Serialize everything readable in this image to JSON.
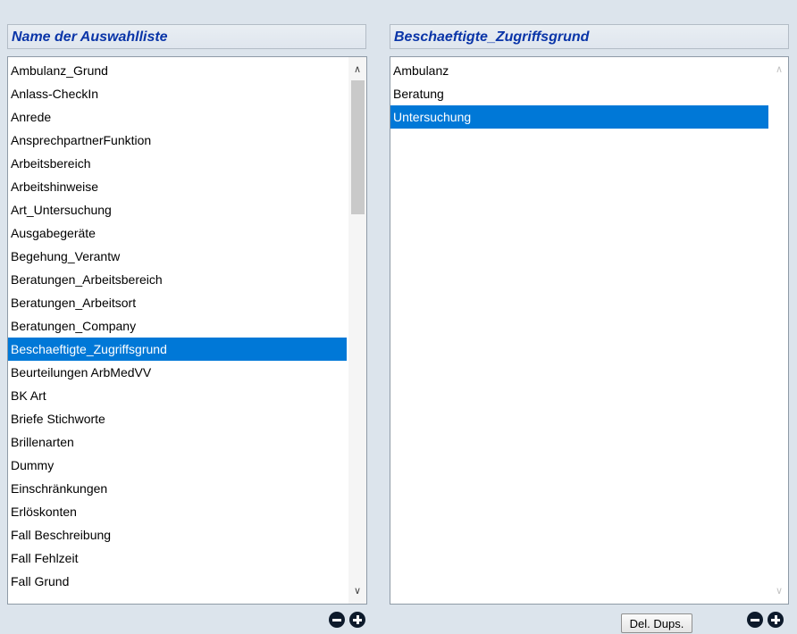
{
  "left_panel": {
    "header": "Name der Auswahlliste",
    "items": [
      "Ambulanz_Grund",
      "Anlass-CheckIn",
      "Anrede",
      "AnsprechpartnerFunktion",
      "Arbeitsbereich",
      "Arbeitshinweise",
      "Art_Untersuchung",
      "Ausgabegeräte",
      "Begehung_Verantw",
      "Beratungen_Arbeitsbereich",
      "Beratungen_Arbeitsort",
      "Beratungen_Company",
      "Beschaeftigte_Zugriffsgrund",
      "Beurteilungen ArbMedVV",
      "BK Art",
      "Briefe Stichworte",
      "Brillenarten",
      "Dummy",
      "Einschränkungen",
      "Erlöskonten",
      "Fall Beschreibung",
      "Fall Fehlzeit",
      "Fall Grund"
    ],
    "selected_index": 12,
    "scroll": {
      "up_arrow": "∧",
      "down_arrow": "∨"
    }
  },
  "right_panel": {
    "header": "Beschaeftigte_Zugriffsgrund",
    "items": [
      "Ambulanz",
      "Beratung",
      "Untersuchung"
    ],
    "selected_index": 2,
    "scroll": {
      "up_arrow": "∧",
      "down_arrow": "∨"
    }
  },
  "buttons": {
    "dedupe_label": "Del. Dups."
  },
  "colors": {
    "selection": "#0078d7",
    "header_text": "#0a35a8",
    "background": "#dce4ec"
  },
  "icons": {
    "remove": "minus-circle-icon",
    "add": "plus-circle-icon"
  }
}
